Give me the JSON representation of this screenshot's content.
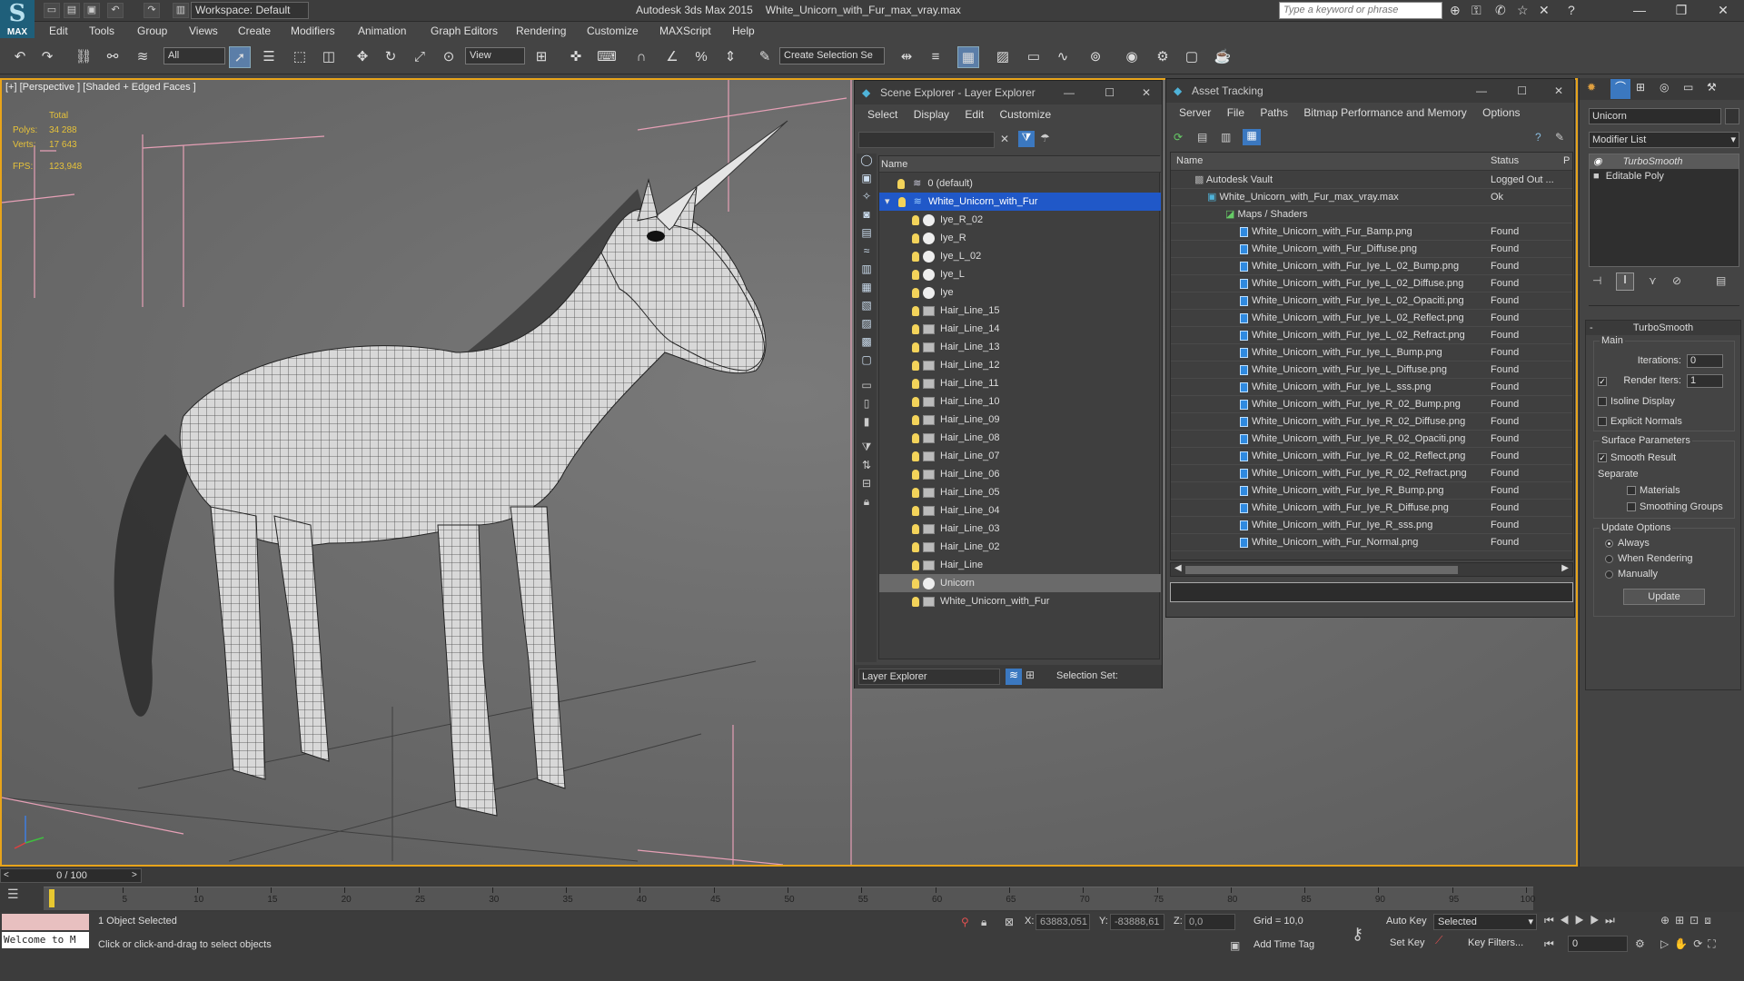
{
  "app": {
    "logo_label": "MAX",
    "workspace": "Workspace: Default",
    "title_app": "Autodesk 3ds Max  2015",
    "title_file": "White_Unicorn_with_Fur_max_vray.max",
    "search_placeholder": "Type a keyword or phrase"
  },
  "menu": [
    "Edit",
    "Tools",
    "Group",
    "Views",
    "Create",
    "Modifiers",
    "Animation",
    "Graph Editors",
    "Rendering",
    "Customize",
    "MAXScript",
    "Help"
  ],
  "toolbar": {
    "filter_select": "All",
    "ref_coord": "View",
    "selection_set": "Create Selection Se"
  },
  "viewport": {
    "label": "[+] [Perspective ] [Shaded + Edged Faces ]",
    "stats_total": "Total",
    "polys_label": "Polys:",
    "polys_value": "34 288",
    "verts_label": "Verts:",
    "verts_value": "17 643",
    "fps_label": "FPS:",
    "fps_value": "123,948"
  },
  "scene_explorer": {
    "title": "Scene Explorer - Layer Explorer",
    "menu": [
      "Select",
      "Display",
      "Edit",
      "Customize"
    ],
    "column": "Name",
    "layer_default": "0 (default)",
    "layer_active": "White_Unicorn_with_Fur",
    "objects": [
      "Iye_R_02",
      "Iye_R",
      "Iye_L_02",
      "Iye_L",
      "Iye",
      "Hair_Line_15",
      "Hair_Line_14",
      "Hair_Line_13",
      "Hair_Line_12",
      "Hair_Line_11",
      "Hair_Line_10",
      "Hair_Line_09",
      "Hair_Line_08",
      "Hair_Line_07",
      "Hair_Line_06",
      "Hair_Line_05",
      "Hair_Line_04",
      "Hair_Line_03",
      "Hair_Line_02",
      "Hair_Line",
      "Unicorn",
      "White_Unicorn_with_Fur"
    ],
    "footer_dropdown": "Layer Explorer",
    "footer_selection": "Selection Set:"
  },
  "asset_tracking": {
    "title": "Asset Tracking",
    "menu": [
      "Server",
      "File",
      "Paths",
      "Bitmap Performance and Memory",
      "Options"
    ],
    "col_name": "Name",
    "col_status": "Status",
    "col_p": "P",
    "vault": {
      "name": "Autodesk Vault",
      "status": "Logged Out ..."
    },
    "file": {
      "name": "White_Unicorn_with_Fur_max_vray.max",
      "status": "Ok"
    },
    "maps_group": "Maps / Shaders",
    "maps": [
      {
        "name": "White_Unicorn_with_Fur_Bamp.png",
        "status": "Found"
      },
      {
        "name": "White_Unicorn_with_Fur_Diffuse.png",
        "status": "Found"
      },
      {
        "name": "White_Unicorn_with_Fur_Iye_L_02_Bump.png",
        "status": "Found"
      },
      {
        "name": "White_Unicorn_with_Fur_Iye_L_02_Diffuse.png",
        "status": "Found"
      },
      {
        "name": "White_Unicorn_with_Fur_Iye_L_02_Opaciti.png",
        "status": "Found"
      },
      {
        "name": "White_Unicorn_with_Fur_Iye_L_02_Reflect.png",
        "status": "Found"
      },
      {
        "name": "White_Unicorn_with_Fur_Iye_L_02_Refract.png",
        "status": "Found"
      },
      {
        "name": "White_Unicorn_with_Fur_Iye_L_Bump.png",
        "status": "Found"
      },
      {
        "name": "White_Unicorn_with_Fur_Iye_L_Diffuse.png",
        "status": "Found"
      },
      {
        "name": "White_Unicorn_with_Fur_Iye_L_sss.png",
        "status": "Found"
      },
      {
        "name": "White_Unicorn_with_Fur_Iye_R_02_Bump.png",
        "status": "Found"
      },
      {
        "name": "White_Unicorn_with_Fur_Iye_R_02_Diffuse.png",
        "status": "Found"
      },
      {
        "name": "White_Unicorn_with_Fur_Iye_R_02_Opaciti.png",
        "status": "Found"
      },
      {
        "name": "White_Unicorn_with_Fur_Iye_R_02_Reflect.png",
        "status": "Found"
      },
      {
        "name": "White_Unicorn_with_Fur_Iye_R_02_Refract.png",
        "status": "Found"
      },
      {
        "name": "White_Unicorn_with_Fur_Iye_R_Bump.png",
        "status": "Found"
      },
      {
        "name": "White_Unicorn_with_Fur_Iye_R_Diffuse.png",
        "status": "Found"
      },
      {
        "name": "White_Unicorn_with_Fur_Iye_R_sss.png",
        "status": "Found"
      },
      {
        "name": "White_Unicorn_with_Fur_Normal.png",
        "status": "Found"
      }
    ]
  },
  "command_panel": {
    "object_name": "Unicorn",
    "modifier_list": "Modifier List",
    "stack": [
      "TurboSmooth",
      "Editable Poly"
    ],
    "rollout_title": "TurboSmooth",
    "main_label": "Main",
    "iterations_label": "Iterations:",
    "iterations_value": "0",
    "render_iters_label": "Render Iters:",
    "render_iters_value": "1",
    "isoline": "Isoline Display",
    "explicit_normals": "Explicit Normals",
    "surface_params": "Surface Parameters",
    "smooth_result": "Smooth Result",
    "separate": "Separate",
    "materials": "Materials",
    "smoothing_groups": "Smoothing Groups",
    "update_options": "Update Options",
    "always": "Always",
    "when_rendering": "When Rendering",
    "manually": "Manually",
    "update_button": "Update"
  },
  "timeline": {
    "frame_counter": "0 / 100",
    "ticks": [
      "5",
      "10",
      "15",
      "20",
      "25",
      "30",
      "35",
      "40",
      "45",
      "50",
      "55",
      "60",
      "65",
      "70",
      "75",
      "80",
      "85",
      "90",
      "95",
      "100"
    ]
  },
  "status": {
    "welcome": "Welcome to M",
    "selected_count": "1 Object Selected",
    "prompt": "Click or click-and-drag to select objects",
    "x_label": "X:",
    "x_value": "63883,051",
    "y_label": "Y:",
    "y_value": "-83888,61",
    "z_label": "Z:",
    "z_value": "0,0",
    "grid": "Grid = 10,0",
    "add_time_tag": "Add Time Tag",
    "auto_key": "Auto Key",
    "set_key": "Set Key",
    "selected_dd": "Selected",
    "key_filters": "Key Filters...",
    "frame_field": "0"
  },
  "colors": {
    "selection_blue": "#2058c8",
    "active_border": "#e8a41a",
    "stats_yellow": "#e6c23a"
  }
}
